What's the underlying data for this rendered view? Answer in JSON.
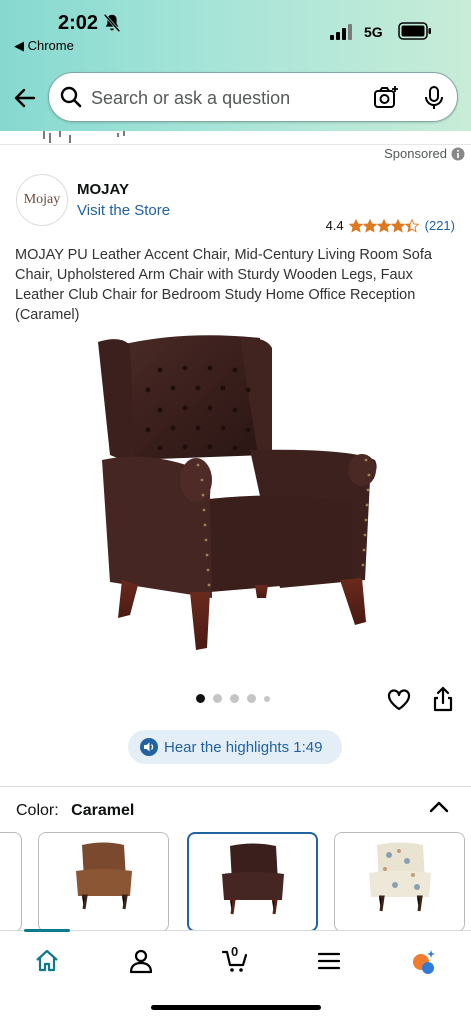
{
  "status_bar": {
    "time": "2:02",
    "back_app": "◀ Chrome",
    "network": "5G",
    "bell_icon": "bell-slash-icon"
  },
  "search": {
    "placeholder": "Search or ask a question"
  },
  "sponsored_label": "Sponsored",
  "brand": {
    "logo_text": "Mojay",
    "name": "MOJAY",
    "store_link": "Visit the Store"
  },
  "rating": {
    "value": "4.4",
    "stars": 4.4,
    "count": "(221)"
  },
  "product": {
    "title": "MOJAY PU Leather Accent Chair, Mid-Century Living Room Sofa Chair, Upholstered Arm Chair with Sturdy Wooden Legs, Faux Leather Club Chair for Bedroom Study Home Office Reception (Caramel)"
  },
  "carousel": {
    "total_dots": 5,
    "active_index": 0
  },
  "highlights": {
    "label": "Hear the highlights 1:49"
  },
  "color": {
    "label": "Color:",
    "value": "Caramel",
    "swatches": [
      {
        "name": "Caramel",
        "selected": false
      },
      {
        "name": "Brown",
        "selected": true
      },
      {
        "name": "Floral",
        "selected": false
      }
    ]
  },
  "bottom_nav": {
    "cart_count": "0",
    "items": [
      "home-icon",
      "account-icon",
      "cart-icon",
      "menu-icon",
      "rufus-icon"
    ]
  },
  "colors": {
    "accent_link": "#2162a1",
    "star": "#de7921",
    "header_gradient_start": "#86d9d0",
    "header_gradient_end": "#c8ecd8"
  }
}
